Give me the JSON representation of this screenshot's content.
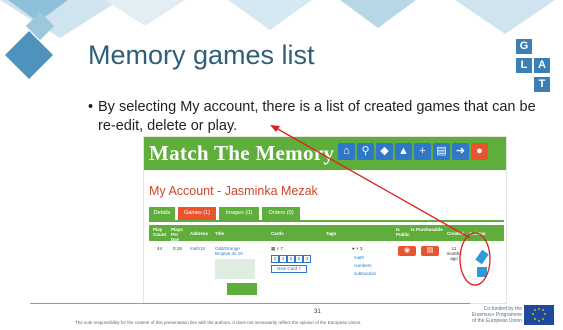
{
  "slide": {
    "title": "Memory games list",
    "bullet_marker": "•",
    "bullet_text": "By selecting My account, there is a list of created games that can be re-edit, delete or play.",
    "page_number": "31",
    "footer_text": "The sole responsibility for the content of this presentation lies with the authors. It does not necessarily reflect the opinion of the European Union.",
    "eu_text_line1": "Co-funded by the",
    "eu_text_line2": "Erasmus+ Programme",
    "eu_text_line3": "of the European Union",
    "logo_letters": [
      "G",
      "L",
      "A",
      "T"
    ]
  },
  "app": {
    "brand": "Match The Memory",
    "nav_icons": [
      "home-icon",
      "search-icon",
      "tag-icon",
      "like-icon",
      "plus-icon",
      "cart-icon",
      "logout-icon"
    ],
    "account_title": "My Account - Jasminka Mezak",
    "tabs": [
      {
        "label": "Details",
        "active": false
      },
      {
        "label": "Games (1)",
        "active": true
      },
      {
        "label": "Images (0)",
        "active": false
      },
      {
        "label": "Orders (0)",
        "active": false
      }
    ],
    "columns": {
      "play_count": "Play Count",
      "plays_per_day": "Plays Per Day",
      "address": "Address",
      "title": "Title",
      "cards": "Cards",
      "tags": "Tags",
      "is_public": "Is Public",
      "is_purchasable": "Is Purchasable",
      "created": "Created",
      "actions": "Actions"
    },
    "row": {
      "play_count": "44",
      "plays_per_day": "0.19",
      "address": "math15",
      "title": "Odd/Orange Brojeve do 10",
      "cards_count": "▦ × 7",
      "cards_buttons": [
        "2",
        "4",
        "6",
        "5",
        "3"
      ],
      "new_card": "New Card 7",
      "tags_count": "● × 3",
      "tags": [
        "math",
        "numbers",
        "subtraction"
      ],
      "created": "11 months ago"
    }
  }
}
